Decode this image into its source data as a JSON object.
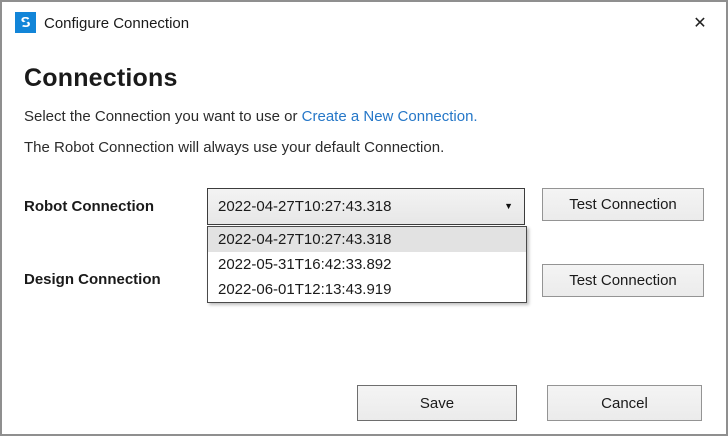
{
  "window": {
    "title": "Configure Connection"
  },
  "icons": {
    "app_icon_letter": "S",
    "close": "✕",
    "dropdown_arrow": "▼"
  },
  "heading": "Connections",
  "intro": {
    "text_before_link": "Select the Connection you want to use or ",
    "link_text": "Create a New Connection.",
    "line2": "The Robot Connection will always use your default Connection."
  },
  "robot_connection": {
    "label": "Robot Connection",
    "selected_value": "2022-04-27T10:27:43.318",
    "test_button_label": "Test Connection"
  },
  "dropdown": {
    "options": [
      "2022-04-27T10:27:43.318",
      "2022-05-31T16:42:33.892",
      "2022-06-01T12:13:43.919"
    ],
    "highlighted_index": 0
  },
  "design_connection": {
    "label": "Design Connection",
    "test_button_label": "Test Connection"
  },
  "footer": {
    "save_label": "Save",
    "cancel_label": "Cancel"
  },
  "colors": {
    "titlebar_icon_bg": "#1285d8",
    "link_blue": "#2577c8",
    "window_border": "#8f8f8f",
    "dropdown_highlight": "#e2e2e2"
  }
}
